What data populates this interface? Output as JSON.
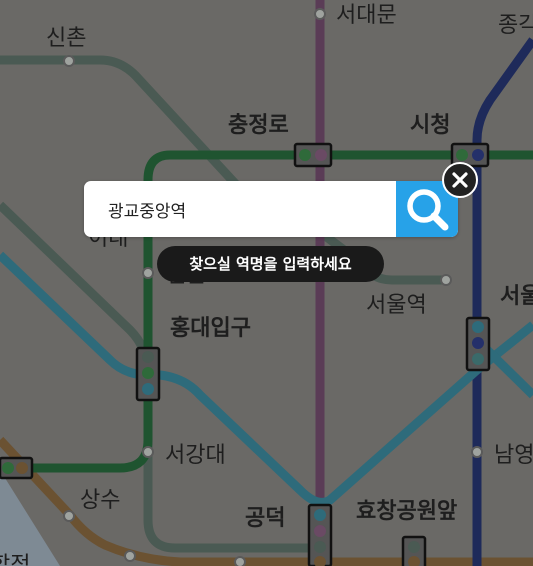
{
  "search": {
    "value": "광교중앙역",
    "hint": "찾으실 역명을 입력하세요"
  },
  "stations": [
    {
      "name": "신촌",
      "bold": false
    },
    {
      "name": "서대문",
      "bold": false
    },
    {
      "name": "종각",
      "bold": false
    },
    {
      "name": "충정로",
      "bold": true
    },
    {
      "name": "시청",
      "bold": true
    },
    {
      "name": "이대",
      "bold": false
    },
    {
      "name": "신촌",
      "bold": false
    },
    {
      "name": "서울역",
      "bold": false
    },
    {
      "name": "서울",
      "bold": true
    },
    {
      "name": "홍대입구",
      "bold": true
    },
    {
      "name": "서강대",
      "bold": false
    },
    {
      "name": "남영",
      "bold": false
    },
    {
      "name": "상수",
      "bold": false
    },
    {
      "name": "공덕",
      "bold": true
    },
    {
      "name": "효창공원앞",
      "bold": true
    },
    {
      "name": "합정",
      "bold": false
    }
  ],
  "colors": {
    "overlay": "#6a6966",
    "line2": "#1f5430",
    "line5": "#5a3c56",
    "line1": "#1e2a5a",
    "line6": "#6b5232",
    "gyeongui": "#2f6063",
    "airport": "#2e6b7b",
    "search_button": "#27a2e8"
  }
}
